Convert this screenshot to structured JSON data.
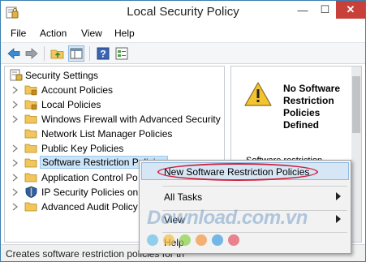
{
  "window": {
    "title": "Local Security Policy",
    "minimize_glyph": "—",
    "maximize_glyph": "☐",
    "close_glyph": "✕"
  },
  "menu": [
    "File",
    "Action",
    "View",
    "Help"
  ],
  "toolbar": {
    "buttons": [
      "back-icon",
      "forward-icon",
      "up-folder-icon",
      "show-hide-tree-icon",
      "help-icon",
      "properties-icon"
    ]
  },
  "tree": {
    "root": "Security Settings",
    "items": [
      {
        "label": "Account Policies",
        "icon": "folder-lock-icon"
      },
      {
        "label": "Local Policies",
        "icon": "folder-lock-icon"
      },
      {
        "label": "Windows Firewall with Advanced Security",
        "icon": "folder-icon"
      },
      {
        "label": "Network List Manager Policies",
        "icon": "folder-icon"
      },
      {
        "label": "Public Key Policies",
        "icon": "folder-icon"
      },
      {
        "label": "Software Restriction Policies",
        "icon": "folder-icon"
      },
      {
        "label": "Application Control Po",
        "icon": "folder-icon"
      },
      {
        "label": "IP Security Policies on",
        "icon": "shield-icon"
      },
      {
        "label": "Advanced Audit Policy",
        "icon": "folder-icon"
      }
    ]
  },
  "right_pane": {
    "heading": "No Software Restriction Policies Defined",
    "body": "Software restriction"
  },
  "status": {
    "text": "Creates software restriction policies for th"
  },
  "context_menu": {
    "items": [
      {
        "label": "New Software Restriction Policies",
        "submenu": false
      },
      {
        "label": "All Tasks",
        "submenu": true
      },
      {
        "label": "View",
        "submenu": true
      },
      {
        "label": "Help",
        "submenu": false
      }
    ]
  },
  "watermark": {
    "text": "Download.com.vn",
    "dot_colors": [
      "#6fc3e8",
      "#f2c14e",
      "#8fd14f",
      "#f39a4a",
      "#4aa3df",
      "#e45c6a"
    ]
  },
  "colors": {
    "highlight_ring": "#d0213b",
    "close_button": "#c7403a",
    "selection": "#cce4f7"
  }
}
